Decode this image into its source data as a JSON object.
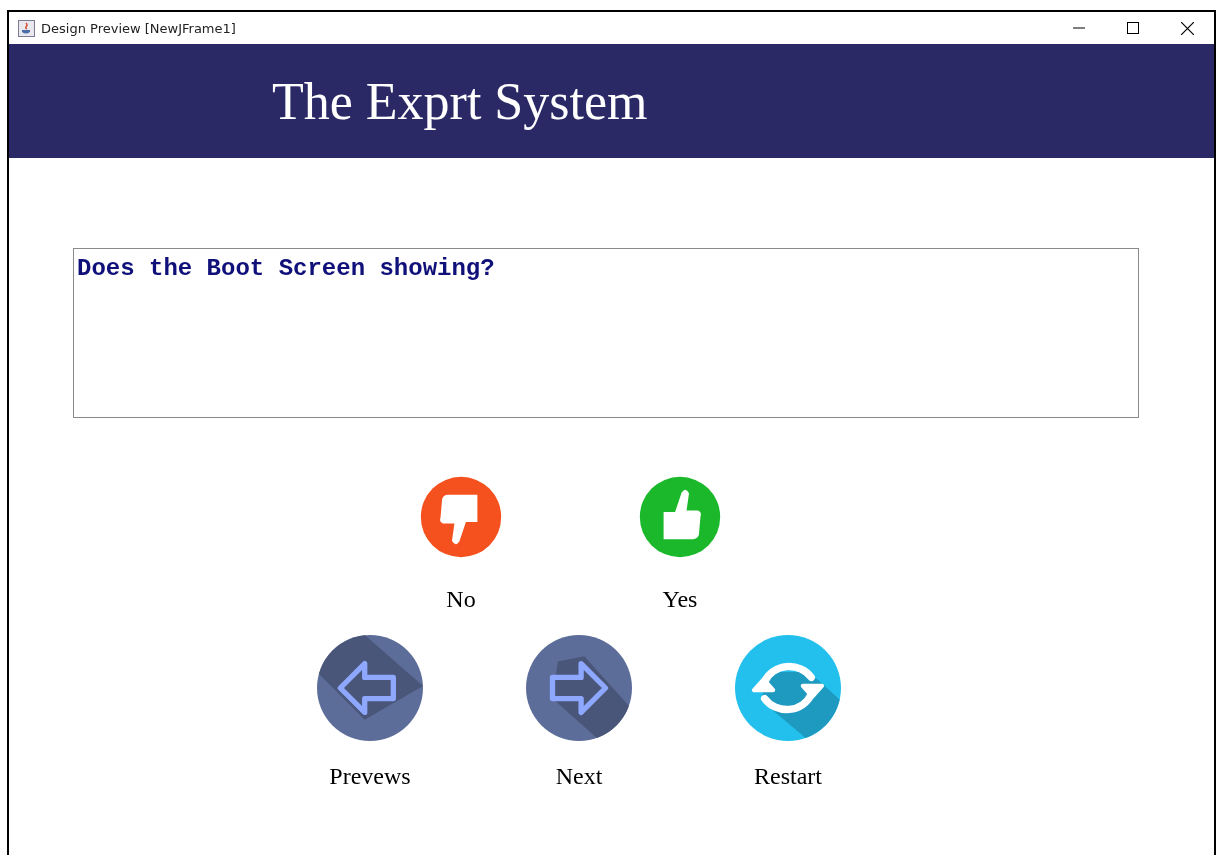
{
  "window": {
    "title": "Design Preview [NewJFrame1]"
  },
  "header": {
    "title": "The Exprt System"
  },
  "question": {
    "text": "Does the Boot Screen showing?"
  },
  "answer_buttons": [
    {
      "label": "No",
      "kind": "no"
    },
    {
      "label": "Yes",
      "kind": "yes"
    }
  ],
  "nav_buttons": [
    {
      "label": "Prevews",
      "kind": "previous"
    },
    {
      "label": "Next",
      "kind": "next"
    },
    {
      "label": "Restart",
      "kind": "restart"
    }
  ]
}
